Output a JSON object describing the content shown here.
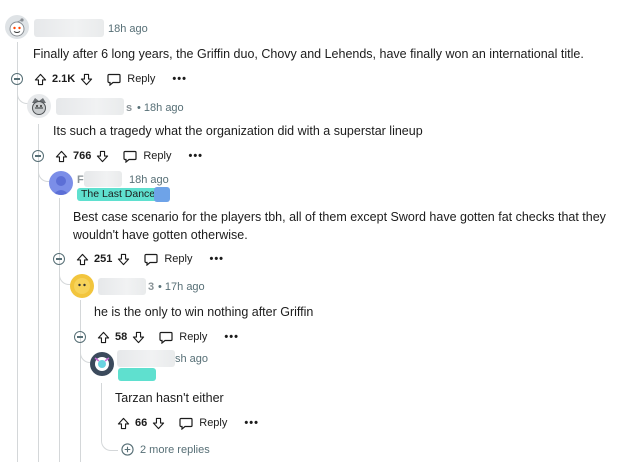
{
  "colors": {
    "thread_line": "#d4d7d9",
    "meta_text": "#576f76",
    "flair_bg": "#5fe0cf",
    "flair_text": "#1c1c1c"
  },
  "comments": [
    {
      "meta": "18h ago",
      "body": "Finally after 6 long years, the Griffin duo, Chovy and Lehends, have finally won an international title.",
      "votes": "2.1K",
      "reply_label": "Reply",
      "more_label": "•••"
    },
    {
      "author_fragment": "s",
      "meta": "• 18h ago",
      "body": "Its such a tragedy what the organization did with a superstar lineup",
      "votes": "766",
      "reply_label": "Reply",
      "more_label": "•••"
    },
    {
      "author_fragment": "F",
      "meta": "18h ago",
      "flair": "The Last Dance",
      "body_lines": [
        "Best case scenario for the players tbh, all of them except Sword have gotten fat checks that they",
        "wouldn't have gotten otherwise."
      ],
      "votes": "251",
      "reply_label": "Reply",
      "more_label": "•••"
    },
    {
      "author_fragment": "3",
      "meta": "• 17h ago",
      "body": "he is the only to win nothing after Griffin",
      "votes": "58",
      "reply_label": "Reply",
      "more_label": "•••"
    },
    {
      "meta": "sh ago",
      "body": "Tarzan hasn't either",
      "votes": "66",
      "reply_label": "Reply",
      "more_label": "•••"
    }
  ],
  "more_replies": "2 more replies"
}
